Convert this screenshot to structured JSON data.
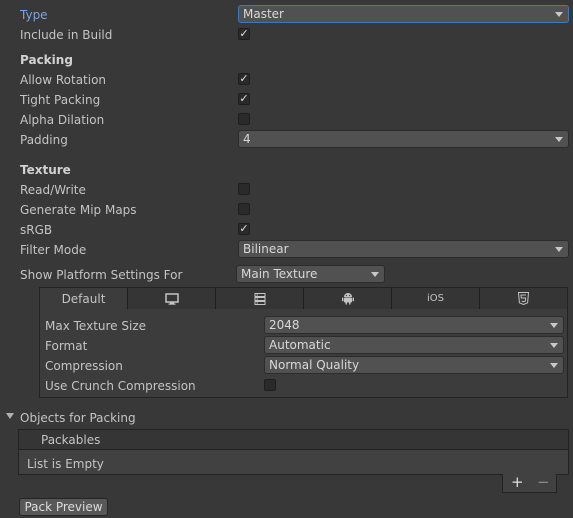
{
  "general": {
    "type_label": "Type",
    "type_value": "Master",
    "include_label": "Include in Build",
    "include_checked": true
  },
  "packing": {
    "header": "Packing",
    "allow_rotation_label": "Allow Rotation",
    "allow_rotation_checked": true,
    "tight_packing_label": "Tight Packing",
    "tight_packing_checked": true,
    "alpha_dilation_label": "Alpha Dilation",
    "alpha_dilation_checked": false,
    "padding_label": "Padding",
    "padding_value": "4"
  },
  "texture": {
    "header": "Texture",
    "readwrite_label": "Read/Write",
    "readwrite_checked": false,
    "mipmaps_label": "Generate Mip Maps",
    "mipmaps_checked": false,
    "srgb_label": "sRGB",
    "srgb_checked": true,
    "filter_label": "Filter Mode",
    "filter_value": "Bilinear"
  },
  "platform": {
    "show_label": "Show Platform Settings For",
    "show_value": "Main Texture",
    "tabs": [
      {
        "label": "Default",
        "icon": ""
      },
      {
        "label": "",
        "icon": "monitor-icon"
      },
      {
        "label": "",
        "icon": "server-icon"
      },
      {
        "label": "",
        "icon": "android-icon"
      },
      {
        "label": "iOS",
        "icon": ""
      },
      {
        "label": "",
        "icon": "html5-icon"
      }
    ],
    "max_size_label": "Max Texture Size",
    "max_size_value": "2048",
    "format_label": "Format",
    "format_value": "Automatic",
    "compression_label": "Compression",
    "compression_value": "Normal Quality",
    "crunch_label": "Use Crunch Compression",
    "crunch_checked": false
  },
  "objects": {
    "foldout_label": "Objects for Packing",
    "list_header": "Packables",
    "empty_text": "List is Empty",
    "add_label": "+",
    "remove_label": "−"
  },
  "actions": {
    "pack_preview_label": "Pack Preview"
  },
  "colors": {
    "background": "#383838",
    "accent": "#7aa6e0",
    "focus_border": "#3a79bb"
  },
  "check_glyph": "✓"
}
